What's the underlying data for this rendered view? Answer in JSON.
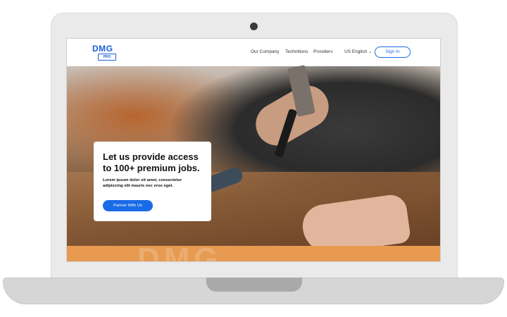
{
  "logo": {
    "main": "DMG",
    "sub": "PRO"
  },
  "nav": {
    "links": [
      "Our Company",
      "Technitions",
      "Providers"
    ],
    "language": "US English",
    "signin": "Sign In"
  },
  "hero": {
    "title": "Let us provide access to 100+ premium jobs.",
    "subtitle": "Lorem ipsum dolor sit amet, consectetur adipiscing elit mauris nec eros eget.",
    "cta": "Partner With Us"
  },
  "footer_banner": {
    "watermark": "DMG"
  },
  "colors": {
    "accent": "#1a6be6",
    "brand": "#1a5fd6",
    "orange": "#e79a50"
  }
}
